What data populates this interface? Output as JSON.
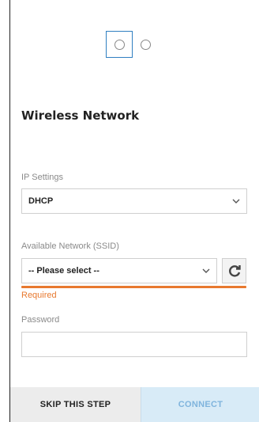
{
  "title": "Wireless Network",
  "ip_settings": {
    "label": "IP Settings",
    "value": "DHCP",
    "chevron_icon": "chevron-down-icon"
  },
  "network": {
    "label": "Available Network (SSID)",
    "value": "-- Please select --",
    "chevron_icon": "chevron-down-icon",
    "refresh_icon": "refresh-icon",
    "error": "Required"
  },
  "password": {
    "label": "Password",
    "value": ""
  },
  "steps": {
    "current": 1,
    "total": 2
  },
  "footer": {
    "skip_label": "SKIP THIS STEP",
    "connect_label": "CONNECT"
  },
  "colors": {
    "accent": "#2f7fc1",
    "error": "#e8792f",
    "connect_bg": "#d8ebf7"
  }
}
